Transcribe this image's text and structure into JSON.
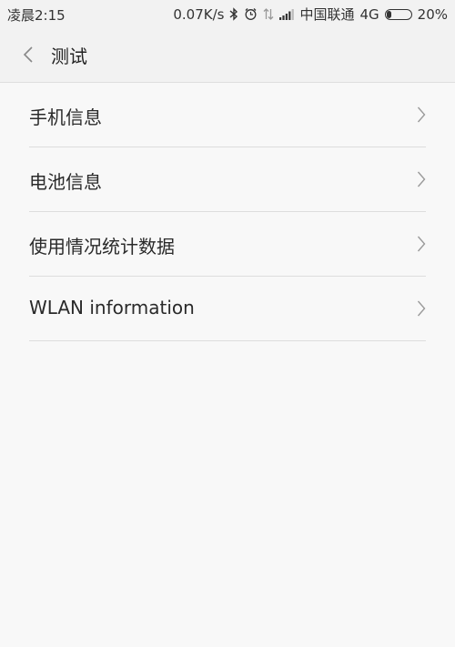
{
  "status_bar": {
    "time": "凌晨2:15",
    "network_speed": "0.07K/s",
    "carrier": "中国联通",
    "network_type": "4G",
    "battery": "20%"
  },
  "header": {
    "title": "测试"
  },
  "list": {
    "items": [
      {
        "label": "手机信息"
      },
      {
        "label": "电池信息"
      },
      {
        "label": "使用情况统计数据"
      },
      {
        "label": "WLAN information"
      }
    ]
  },
  "colors": {
    "background": "#f8f8f8",
    "header_background": "#f2f2f2",
    "divider": "#dddddd",
    "text": "#2a2a2a",
    "chevron": "#9a9a9a"
  }
}
